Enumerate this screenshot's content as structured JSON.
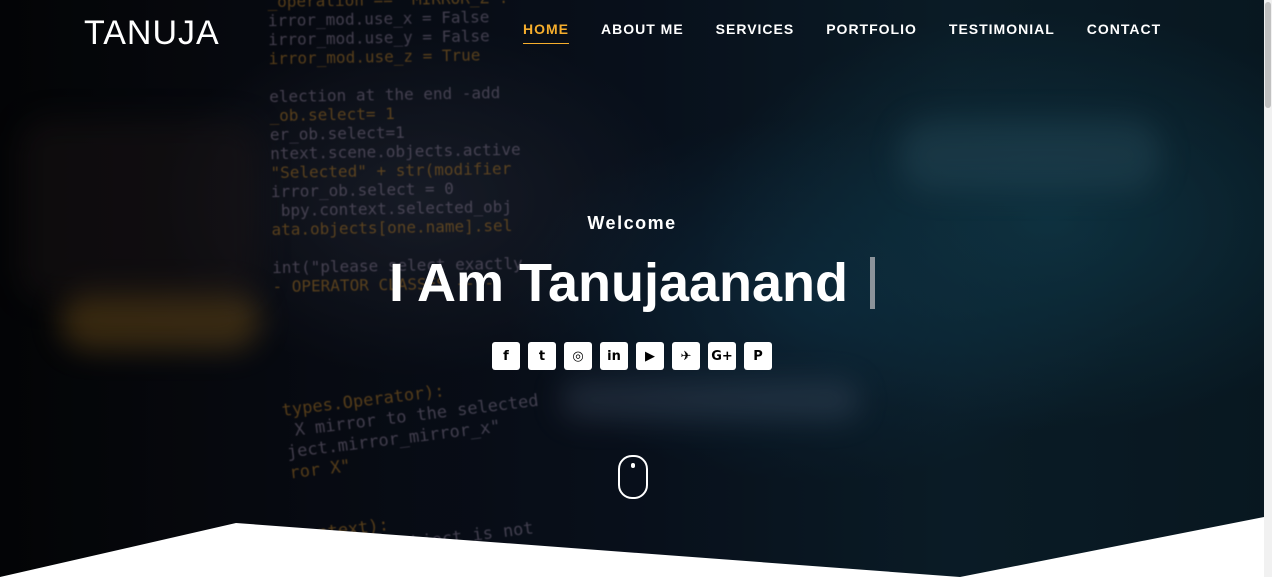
{
  "brand": {
    "logo": "TANUJA"
  },
  "nav": {
    "items": [
      {
        "label": "HOME",
        "active": true
      },
      {
        "label": "ABOUT ME",
        "active": false
      },
      {
        "label": "SERVICES",
        "active": false
      },
      {
        "label": "PORTFOLIO",
        "active": false
      },
      {
        "label": "TESTIMONIAL",
        "active": false
      },
      {
        "label": "CONTACT",
        "active": false
      }
    ]
  },
  "hero": {
    "welcome": "Welcome",
    "headline": "I Am Tanujaanand",
    "background_code_top": [
      "_operation == \"MIRROR_Z\":",
      "irror_mod.use_x = False",
      "irror_mod.use_y = False",
      "irror_mod.use_z = True",
      "",
      "election at the end -add",
      "_ob.select= 1",
      "er_ob.select=1",
      "ntext.scene.objects.active",
      "\"Selected\" + str(modifier",
      "irror_ob.select = 0",
      " bpy.context.selected_obj",
      "ata.objects[one.name].sel",
      "",
      "int(\"please select exactly",
      "- OPERATOR CLASSES ----"
    ],
    "background_code_bottom": [
      "types.Operator):",
      " X mirror to the selected",
      "ject.mirror_mirror_x\"",
      "ror X\"",
      "",
      "",
      "context):",
      "   active_object is not"
    ]
  },
  "social": [
    {
      "name": "facebook-icon",
      "glyph": "f"
    },
    {
      "name": "twitter-icon",
      "glyph": "t"
    },
    {
      "name": "instagram-icon",
      "glyph": "◎"
    },
    {
      "name": "linkedin-icon",
      "glyph": "in"
    },
    {
      "name": "youtube-icon",
      "glyph": "▶"
    },
    {
      "name": "telegram-icon",
      "glyph": "✈"
    },
    {
      "name": "google-plus-icon",
      "glyph": "G+"
    },
    {
      "name": "pinterest-icon",
      "glyph": "P"
    }
  ],
  "colors": {
    "accent": "#f6ae2d",
    "text": "#ffffff",
    "divider": "#ffffff"
  }
}
